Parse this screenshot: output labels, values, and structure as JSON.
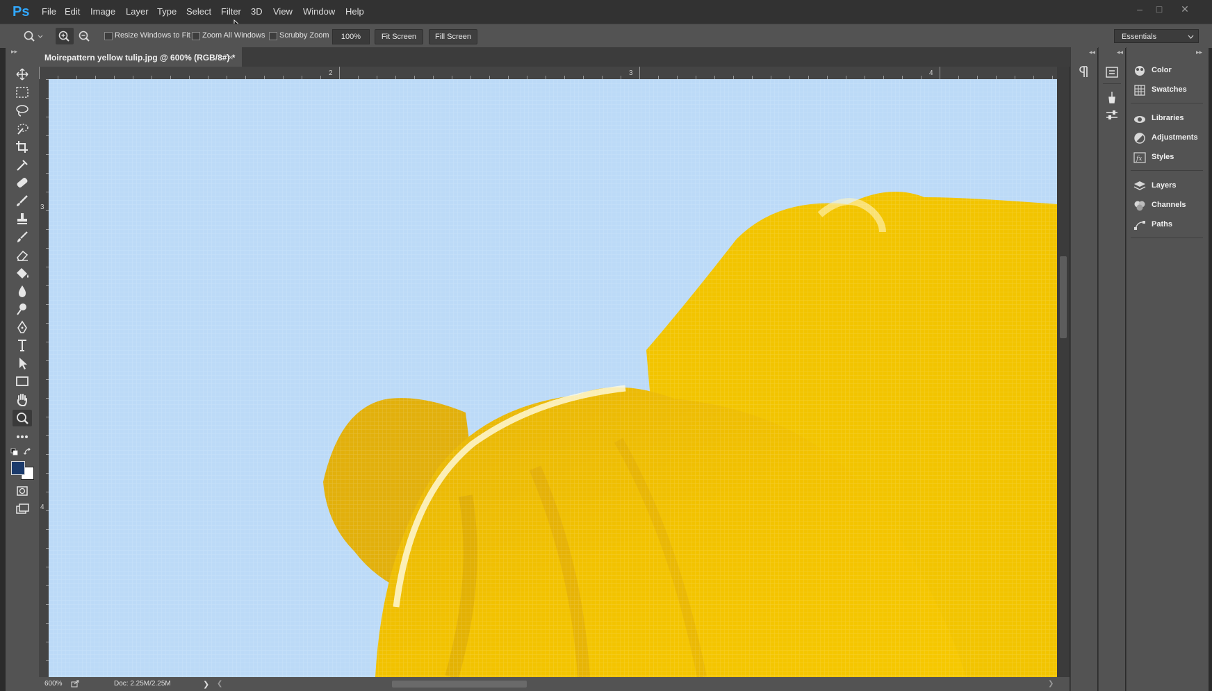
{
  "app": {
    "logo": "Ps"
  },
  "menu": {
    "items": [
      "File",
      "Edit",
      "Image",
      "Layer",
      "Type",
      "Select",
      "Filter",
      "3D",
      "View",
      "Window",
      "Help"
    ]
  },
  "options_bar": {
    "resize_windows_label": "Resize Windows to Fit",
    "zoom_all_windows_label": "Zoom All Windows",
    "scrubby_zoom_label": "Scrubby Zoom",
    "zoom_value": "100%",
    "fit_screen_label": "Fit Screen",
    "fill_screen_label": "Fill Screen",
    "workspace": "Essentials"
  },
  "document": {
    "tab_title": "Moirepattern yellow tulip.jpg @ 600% (RGB/8#) *",
    "close_glyph": "×"
  },
  "rulers": {
    "h_labels": [
      "2",
      "3",
      "4"
    ],
    "v_labels": [
      "3",
      "4"
    ]
  },
  "status": {
    "zoom": "600%",
    "doc_info": "Doc: 2.25M/2.25M"
  },
  "panels": {
    "items": [
      {
        "label": "Color",
        "icon": "color-icon"
      },
      {
        "label": "Swatches",
        "icon": "swatches-icon"
      },
      {
        "label": "Libraries",
        "icon": "libraries-icon"
      },
      {
        "label": "Adjustments",
        "icon": "adjustments-icon"
      },
      {
        "label": "Styles",
        "icon": "styles-icon"
      },
      {
        "label": "Layers",
        "icon": "layers-icon"
      },
      {
        "label": "Channels",
        "icon": "channels-icon"
      },
      {
        "label": "Paths",
        "icon": "paths-icon"
      }
    ]
  },
  "colors": {
    "foreground": "#1b3a6b",
    "background": "#ffffff",
    "sky": "#bcdaf7",
    "tulip": "#f0c000"
  }
}
